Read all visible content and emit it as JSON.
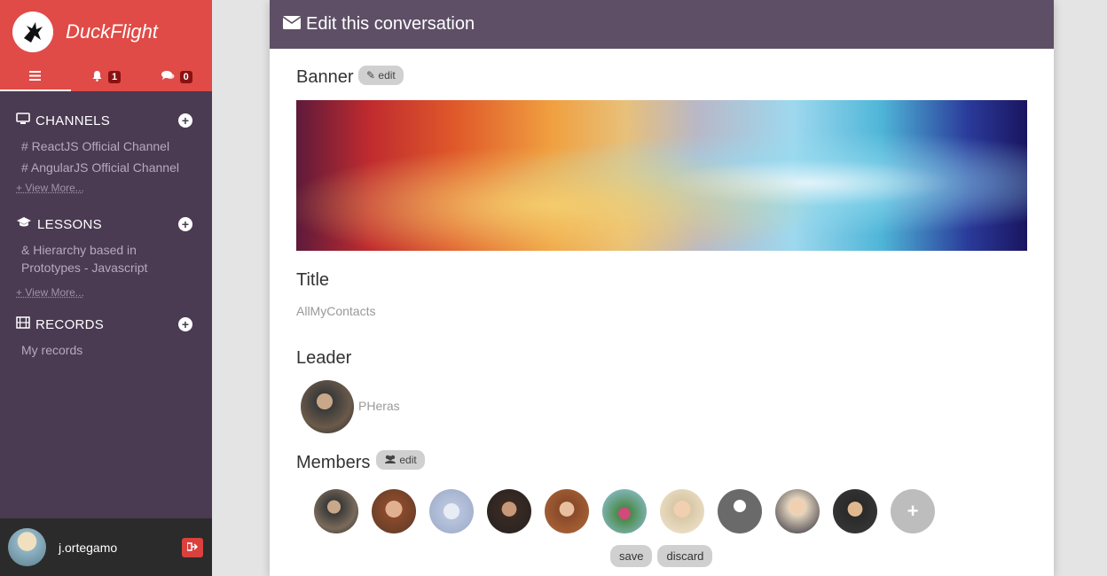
{
  "app": {
    "name": "DuckFlight"
  },
  "tabs": [
    {
      "icon": "menu-icon",
      "count": ""
    },
    {
      "icon": "bell-icon",
      "count": "1"
    },
    {
      "icon": "comments-icon",
      "count": "0"
    }
  ],
  "sidebar": {
    "channels": {
      "title": "CHANNELS",
      "items": [
        "# ReactJS Official Channel",
        "# AngularJS Official Channel"
      ],
      "view_more": "+ View More..."
    },
    "lessons": {
      "title": "LESSONS",
      "items": [
        "& Hierarchy based in Prototypes - Javascript"
      ],
      "view_more": "+ View More..."
    },
    "records": {
      "title": "RECORDS",
      "items": [
        "My records"
      ]
    }
  },
  "user": {
    "name": "j.ortegamo"
  },
  "panel": {
    "header": "Edit this conversation",
    "banner_label": "Banner",
    "edit_label": "edit",
    "title_label": "Title",
    "title_value": "AllMyContacts",
    "leader_label": "Leader",
    "leader_name": "PHeras",
    "members_label": "Members",
    "members_edit_label": "edit",
    "add_member": "+",
    "save": "save",
    "discard": "discard"
  },
  "colors": {
    "brand": "#e04b47",
    "sidebar": "#4a3a52",
    "header": "#5e4f66"
  }
}
